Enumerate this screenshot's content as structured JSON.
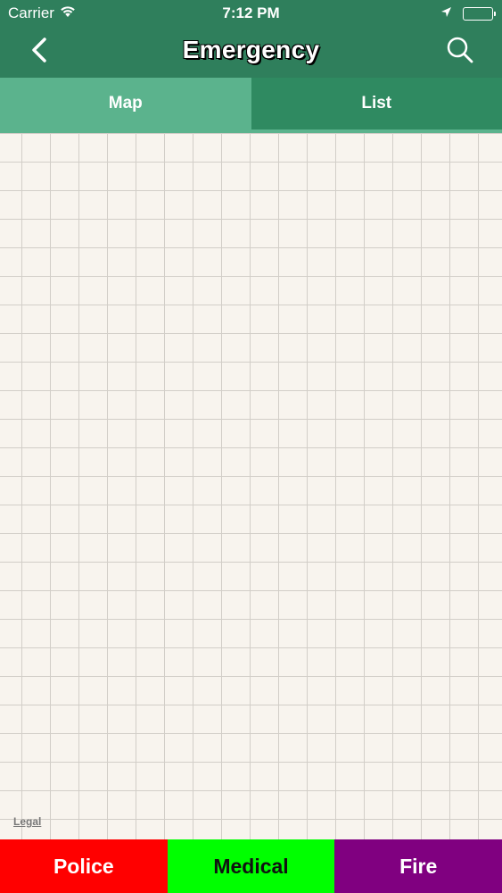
{
  "status_bar": {
    "carrier": "Carrier",
    "time": "7:12 PM",
    "icons": [
      "wifi-icon",
      "location-arrow-icon",
      "battery-icon"
    ]
  },
  "nav": {
    "title": "Emergency",
    "back_icon": "chevron-left-icon",
    "search_icon": "search-icon"
  },
  "tabs": [
    {
      "label": "Map",
      "active": true
    },
    {
      "label": "List",
      "active": false
    }
  ],
  "map": {
    "legal_label": "Legal"
  },
  "bottom_buttons": {
    "police": "Police",
    "medical": "Medical",
    "fire": "Fire"
  },
  "colors": {
    "nav_green": "#2f7f5c",
    "tab_active": "#5bb38d",
    "tab_inactive": "#2f8a61",
    "police": "#ff0000",
    "medical": "#00ff00",
    "fire": "#800080"
  }
}
